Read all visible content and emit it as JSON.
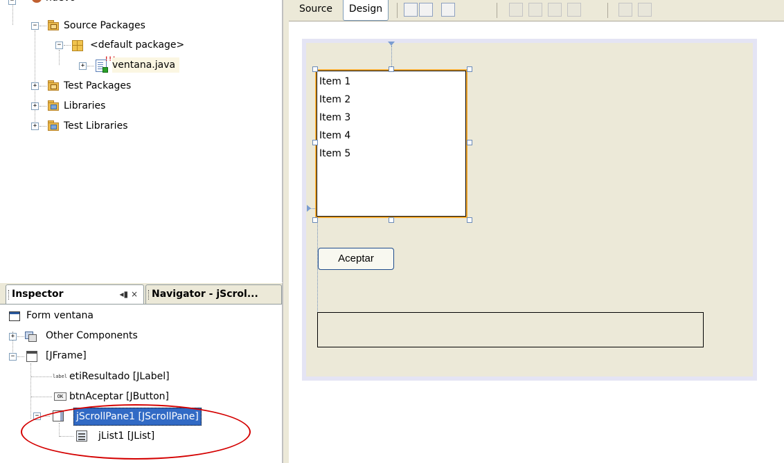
{
  "projects_tree": {
    "root_label": "nuevo",
    "source_packages": "Source Packages",
    "default_package": "<default package>",
    "java_file": "ventana.java",
    "test_packages": "Test Packages",
    "libraries": "Libraries",
    "test_libraries": "Test Libraries",
    "file_badge": "!!!"
  },
  "inspector": {
    "tab_label": "Inspector",
    "tab_controls": "◂▮ ×",
    "navigator_tab_label": "Navigator - jScrol...",
    "form_label": "Form ventana",
    "other_components": "Other Components",
    "jframe": "[JFrame]",
    "eti_resultado": "etiResultado [JLabel]",
    "btn_aceptar": "btnAceptar [JButton]",
    "jscrollpane": "jScrollPane1 [JScrollPane]",
    "jlist": "jList1 [JList]",
    "label_icon_text": "label",
    "button_icon_text": "OK"
  },
  "editor": {
    "source_tab": "Source",
    "design_tab": "Design"
  },
  "form": {
    "list_items": [
      "Item 1",
      "Item 2",
      "Item 3",
      "Item 4",
      "Item 5"
    ],
    "button_label": "Aceptar"
  }
}
